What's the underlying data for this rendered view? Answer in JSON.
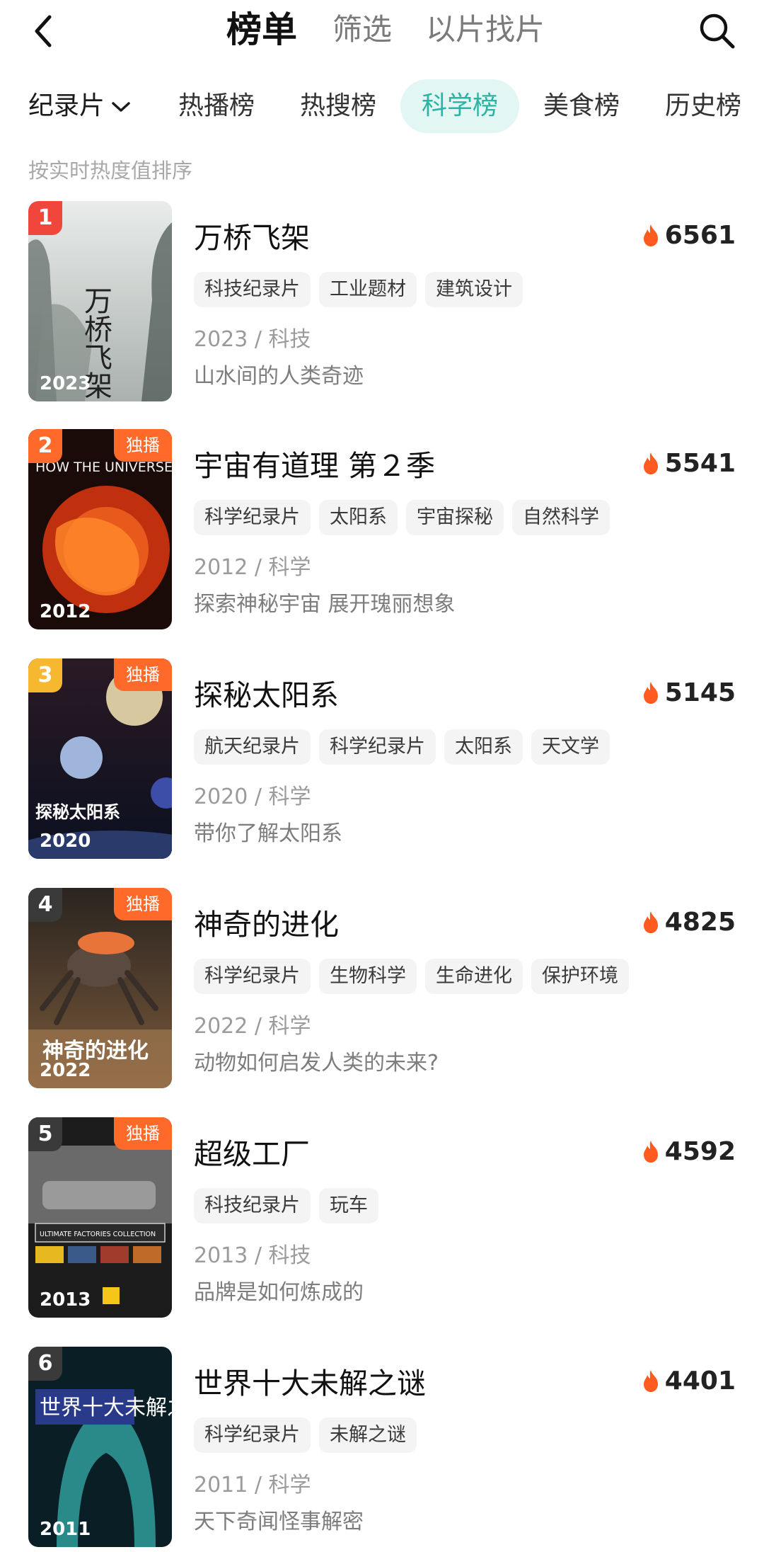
{
  "header": {
    "tabs": [
      {
        "label": "榜单",
        "active": true
      },
      {
        "label": "筛选",
        "active": false
      },
      {
        "label": "以片找片",
        "active": false
      }
    ],
    "back_icon": "chevron-left-icon",
    "search_icon": "search-icon"
  },
  "category": {
    "dropdown_label": "纪录片",
    "tabs": [
      {
        "label": "热播榜",
        "active": false
      },
      {
        "label": "热搜榜",
        "active": false
      },
      {
        "label": "科学榜",
        "active": true
      },
      {
        "label": "美食榜",
        "active": false
      },
      {
        "label": "历史榜",
        "active": false
      }
    ],
    "accent_color": "#2bb3a4"
  },
  "sort_hint": "按实时热度值排序",
  "items": [
    {
      "rank": "1",
      "exclusive": "",
      "poster_year": "2023",
      "title": "万桥飞架",
      "heat": "6561",
      "tags": [
        "科技纪录片",
        "工业题材",
        "建筑设计"
      ],
      "meta": "2023 / 科技",
      "desc": "山水间的人类奇迹",
      "poster_text": "万桥飞架"
    },
    {
      "rank": "2",
      "exclusive": "独播",
      "poster_year": "2012",
      "title": "宇宙有道理 第２季",
      "heat": "5541",
      "tags": [
        "科学纪录片",
        "太阳系",
        "宇宙探秘",
        "自然科学"
      ],
      "meta": "2012 / 科学",
      "desc": "探索神秘宇宙 展开瑰丽想象",
      "poster_text": "HOW THE UNIVERSE WORKS 宇宙有道理"
    },
    {
      "rank": "3",
      "exclusive": "独播",
      "poster_year": "2020",
      "title": "探秘太阳系",
      "heat": "5145",
      "tags": [
        "航天纪录片",
        "科学纪录片",
        "太阳系",
        "天文学"
      ],
      "meta": "2020 / 科学",
      "desc": "带你了解太阳系",
      "poster_text": "探秘太阳系"
    },
    {
      "rank": "4",
      "exclusive": "独播",
      "poster_year": "2022",
      "title": "神奇的进化",
      "heat": "4825",
      "tags": [
        "科学纪录片",
        "生物科学",
        "生命进化",
        "保护环境"
      ],
      "meta": "2022 / 科学",
      "desc": "动物如何启发人类的未来?",
      "poster_text": "神奇的进化"
    },
    {
      "rank": "5",
      "exclusive": "独播",
      "poster_year": "2013",
      "title": "超级工厂",
      "heat": "4592",
      "tags": [
        "科技纪录片",
        "玩车"
      ],
      "meta": "2013 / 科技",
      "desc": "品牌是如何炼成的",
      "poster_text": "ULTIMATE FACTORIES COLLECTION"
    },
    {
      "rank": "6",
      "exclusive": "",
      "poster_year": "2011",
      "title": "世界十大未解之谜",
      "heat": "4401",
      "tags": [
        "科学纪录片",
        "未解之谜"
      ],
      "meta": "2011 / 科学",
      "desc": "天下奇闻怪事解密",
      "poster_text": "世界十大未解之谜"
    }
  ],
  "colors": {
    "rank1": "#f0463c",
    "rank2": "#ff6a2a",
    "rank3": "#f5b82e",
    "rank_other": "#3a3a3a",
    "heat_icon": "#ff5a1f",
    "exclusive_badge": "#ff6a2a"
  }
}
